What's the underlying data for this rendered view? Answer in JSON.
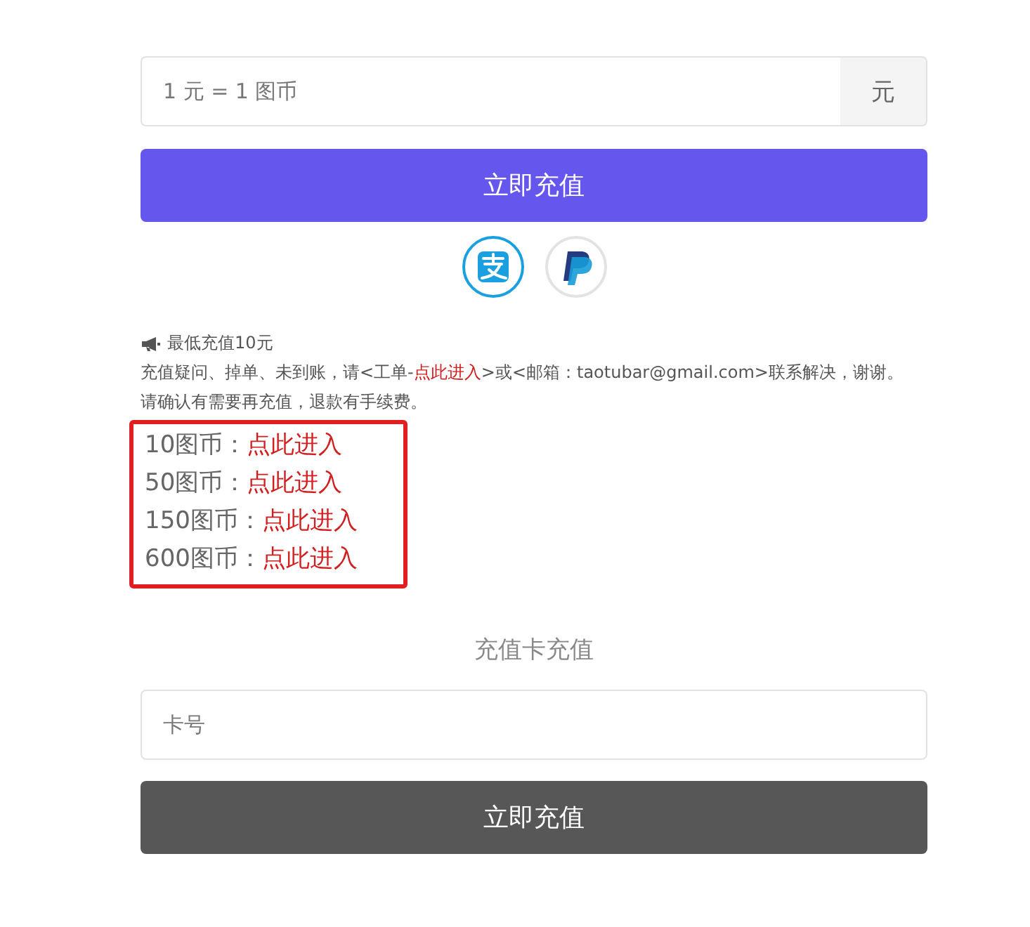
{
  "amount_field": {
    "placeholder": "1 元 = 1 图币",
    "unit": "元"
  },
  "submit_button": "立即充值",
  "payment_methods": [
    {
      "kind": "alipay",
      "selected": true
    },
    {
      "kind": "paypal",
      "selected": false
    }
  ],
  "notice": {
    "headline": "最低充值10元",
    "contact_before": "充值疑问、掉单、未到账，请<工单-",
    "contact_link": "点此进入",
    "contact_after": ">或<邮箱：taotubar@gmail.com>联系解决，谢谢。",
    "warning": "请确认有需要再充值，退款有手续费。"
  },
  "recharge_options": {
    "highlighted": true,
    "items": [
      {
        "label": "10图币：",
        "link": "点此进入"
      },
      {
        "label": "50图币：",
        "link": "点此进入"
      },
      {
        "label": "150图币：",
        "link": "点此进入"
      },
      {
        "label": "600图币：",
        "link": "点此进入"
      }
    ]
  },
  "card_section": {
    "title": "充值卡充值",
    "placeholder": "卡号",
    "button": "立即充值"
  }
}
